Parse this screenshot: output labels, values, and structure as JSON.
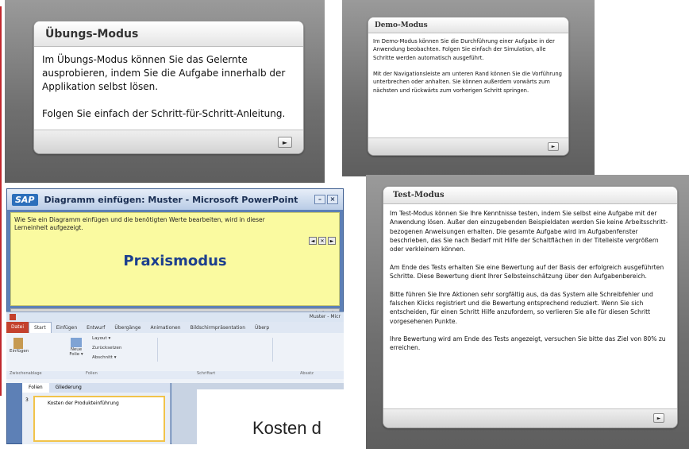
{
  "uebung": {
    "title": "Übungs-Modus",
    "body": "Im Übungs-Modus können Sie das Gelernte ausprobieren, indem Sie die Aufgabe innerhalb der Applikation selbst lösen.\n\nFolgen Sie einfach der Schritt-für-Schritt-Anleitung.",
    "play": "►"
  },
  "demo": {
    "title": "Demo-Modus",
    "body": "Im Demo-Modus können Sie die Durchführung einer Aufgabe in der Anwendung beobachten. Folgen Sie einfach der Simulation, alle Schritte werden automatisch ausgeführt.\n\nMit der Navigationsleiste am unteren Rand können Sie die Vorführung unterbrechen oder anhalten. Sie können außerdem vorwärts zum nächsten und rückwärts zum vorherigen Schritt springen.",
    "play": "►"
  },
  "test": {
    "title": "Test-Modus",
    "body": "Im Test-Modus können Sie Ihre Kenntnisse testen, indem Sie selbst eine Aufgabe mit der Anwendung lösen. Außer den einzugebenden Beispieldaten werden Sie keine Arbeitsschritt-bezogenen Anweisungen erhalten. Die gesamte Aufgabe wird im Aufgabenfenster beschrieben, das Sie nach Bedarf mit Hilfe der Schaltflächen in der Titelleiste vergrößern oder verkleinern können.\n\nAm Ende des Tests erhalten Sie eine Bewertung auf der Basis der erfolgreich ausgeführten Schritte. Diese Bewertung dient Ihrer Selbsteinschätzung über den Aufgabenbereich.\n\nBitte führen Sie Ihre Aktionen sehr sorgfältig aus, da das System alle Schreibfehler und falschen Klicks registriert und die Bewertung entsprechend reduziert. Wenn Sie sich entscheiden, für einen Schritt Hilfe anzufordern, so verlieren Sie alle für diesen Schritt vorgesehenen Punkte.\n\nIhre Bewertung wird am Ende des Tests angezeigt, versuchen Sie bitte das Ziel von 80% zu erreichen.",
    "play": "►"
  },
  "praxis": {
    "sap": "SAP",
    "window_title": "Diagramm einfügen: Muster - Microsoft PowerPoint",
    "instruction": "Wie Sie ein Diagramm einfügen und die benötigten Werte bearbeiten, wird in dieser Lerneinheit aufgezeigt.",
    "label": "Praxismodus",
    "ppt_title": "Muster - Micr",
    "tabs": [
      "Datei",
      "Start",
      "Einfügen",
      "Entwurf",
      "Übergänge",
      "Animationen",
      "Bildschirmpräsentation",
      "Überp"
    ],
    "groups": [
      "Zwischenablage",
      "Folien",
      "Schriftart",
      "Absatz"
    ],
    "layout": "Layout ▾",
    "reset": "Zurücksetzen",
    "section": "Abschnitt ▾",
    "paste": "Einfügen",
    "new_slide": "Neue Folie ▾",
    "panel_tabs": [
      "Folien",
      "Gliederung"
    ],
    "slide_num": "3",
    "slide_thumb": "Kosten der Produkteinführung",
    "slide_big": "Kosten d"
  }
}
